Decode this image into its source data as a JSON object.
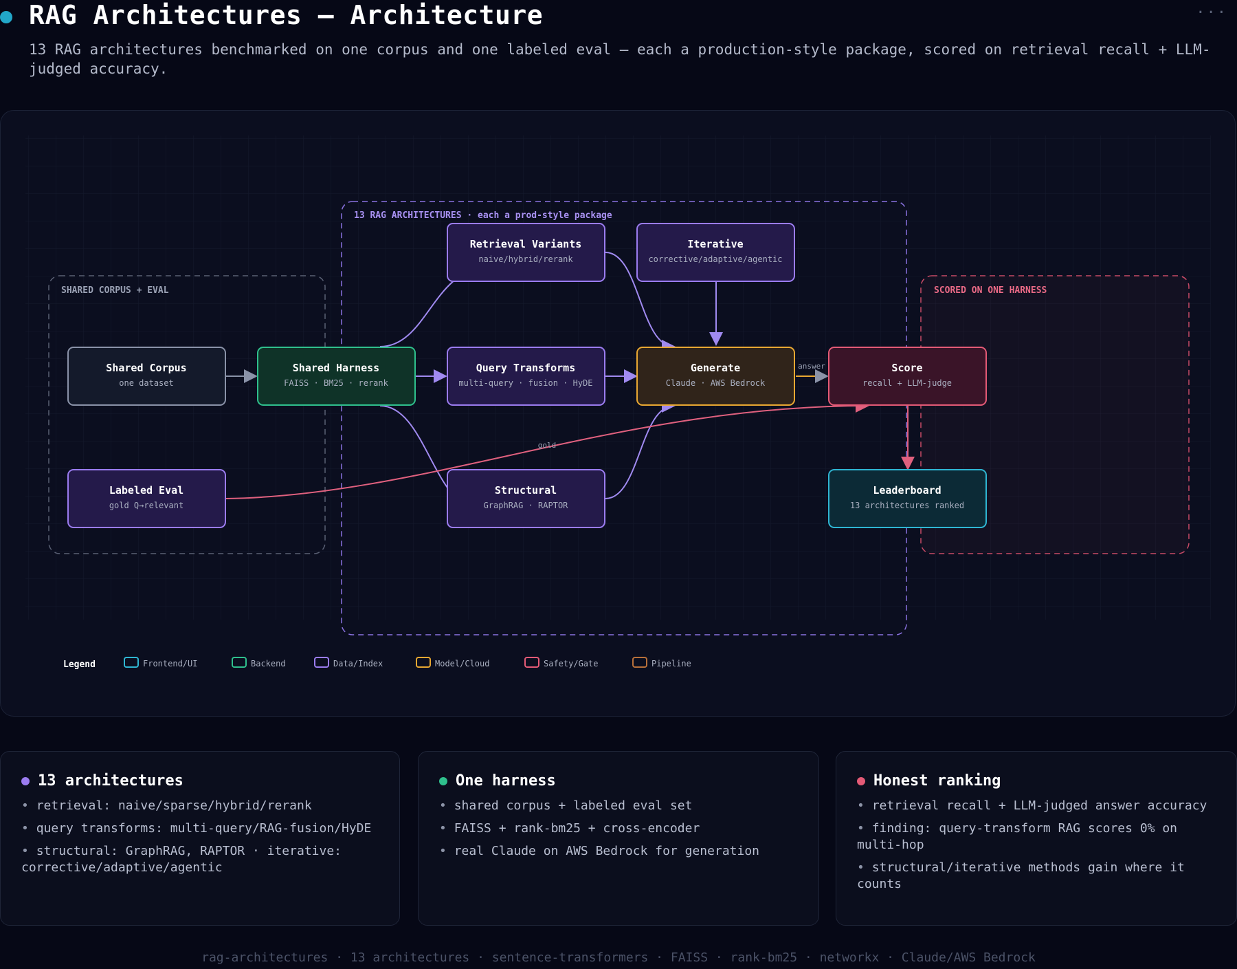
{
  "header": {
    "title": "RAG Architectures — Architecture",
    "subtitle": "13 RAG architectures benchmarked on one corpus and one labeled eval — each a production-style package, scored on retrieval recall + LLM-judged accuracy."
  },
  "diagram": {
    "groups": {
      "corpus_eval": "SHARED CORPUS + EVAL",
      "architectures": "13 RAG ARCHITECTURES · each a prod-style package",
      "harness": "SCORED ON ONE HARNESS"
    },
    "nodes": {
      "shared_corpus": {
        "title": "Shared Corpus",
        "sub": "one dataset"
      },
      "labeled_eval": {
        "title": "Labeled Eval",
        "sub": "gold Q→relevant"
      },
      "shared_harness": {
        "title": "Shared Harness",
        "sub": "FAISS · BM25 · rerank"
      },
      "retrieval_variants": {
        "title": "Retrieval Variants",
        "sub": "naive/hybrid/rerank"
      },
      "query_transforms": {
        "title": "Query Transforms",
        "sub": "multi-query · fusion · HyDE"
      },
      "structural": {
        "title": "Structural",
        "sub": "GraphRAG · RAPTOR"
      },
      "iterative": {
        "title": "Iterative",
        "sub": "corrective/adaptive/agentic"
      },
      "generate": {
        "title": "Generate",
        "sub": "Claude · AWS Bedrock"
      },
      "score": {
        "title": "Score",
        "sub": "recall + LLM-judge"
      },
      "leaderboard": {
        "title": "Leaderboard",
        "sub": "13 architectures ranked"
      }
    },
    "edge_labels": {
      "answer": "answer",
      "gold": "gold"
    },
    "colors": {
      "frontend": "#2fb6d3",
      "backend": "#2fc08d",
      "data": "#9b7cf0",
      "model": "#e9a832",
      "safety": "#e45a76",
      "pipeline": "#b8703a",
      "edge": "#8a92a8",
      "gold_edge": "#e0607e"
    },
    "legend": {
      "title": "Legend",
      "items": [
        {
          "label": "Frontend/UI",
          "color": "#2fb6d3"
        },
        {
          "label": "Backend",
          "color": "#2fc08d"
        },
        {
          "label": "Data/Index",
          "color": "#9b7cf0"
        },
        {
          "label": "Model/Cloud",
          "color": "#e9a832"
        },
        {
          "label": "Safety/Gate",
          "color": "#e45a76"
        },
        {
          "label": "Pipeline",
          "color": "#b8703a"
        }
      ]
    }
  },
  "cards": [
    {
      "title": "13 architectures",
      "dot_color": "#9b7cf0",
      "items": [
        "retrieval: naive/sparse/hybrid/rerank",
        "query transforms: multi-query/RAG-fusion/HyDE",
        "structural: GraphRAG, RAPTOR · iterative: corrective/adaptive/agentic"
      ]
    },
    {
      "title": "One harness",
      "dot_color": "#2fc08d",
      "items": [
        "shared corpus + labeled eval set",
        "FAISS + rank-bm25 + cross-encoder",
        "real Claude on AWS Bedrock for generation"
      ]
    },
    {
      "title": "Honest ranking",
      "dot_color": "#e45a76",
      "items": [
        "retrieval recall + LLM-judged answer accuracy",
        "finding: query-transform RAG scores 0% on multi-hop",
        "structural/iterative methods gain where it counts"
      ]
    }
  ],
  "footer": "rag-architectures · 13 architectures · sentence-transformers · FAISS · rank-bm25 · networkx · Claude/AWS Bedrock"
}
